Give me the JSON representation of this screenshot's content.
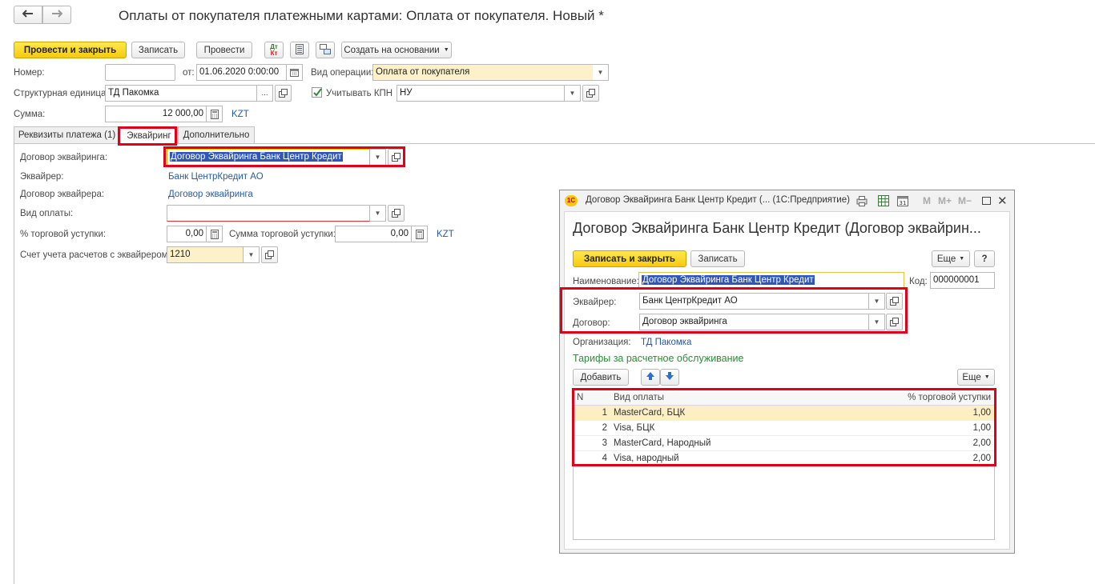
{
  "window": {
    "title": "Оплаты от покупателя платежными картами: Оплата от покупателя. Новый *"
  },
  "toolbar": {
    "post_close": "Провести и закрыть",
    "save": "Записать",
    "post": "Провести",
    "dt_kt_label_top": "Дт",
    "dt_kt_label_bottom": "Кт",
    "create_based": "Создать на основании"
  },
  "header": {
    "number_label": "Номер:",
    "number_value": "",
    "from_label": "от:",
    "date_value": "01.06.2020  0:00:00",
    "op_type_label": "Вид операции:",
    "op_type_value": "Оплата от покупателя",
    "unit_label": "Структурная единица:",
    "unit_value": "ТД Пакомка",
    "unit_ellipsis": "...",
    "kpn_label": "Учитывать КПН",
    "kpn_value": "НУ",
    "sum_label": "Сумма:",
    "sum_value": "12 000,00",
    "currency": "KZT"
  },
  "tabs": [
    {
      "label": "Реквизиты платежа (1)"
    },
    {
      "label": "Эквайринг"
    },
    {
      "label": "Дополнительно"
    }
  ],
  "acquiring": {
    "contract_label": "Договор эквайринга:",
    "contract_value": "Договор Эквайринга Банк Центр Кредит",
    "acquirer_label": "Эквайрер:",
    "acquirer_value": "Банк ЦентрКредит АО",
    "acq_contract_label": "Договор эквайрера:",
    "acq_contract_value": "Договор эквайринга",
    "pay_type_label": "Вид оплаты:",
    "pay_type_value": "",
    "discount_label": "% торговой уступки:",
    "discount_value": "0,00",
    "discount_sum_label": "Сумма торговой уступки:",
    "discount_sum_value": "0,00",
    "currency": "KZT",
    "account_label": "Счет учета расчетов с эквайрером:",
    "account_value": "1210"
  },
  "dialog": {
    "title": "Договор Эквайринга Банк Центр Кредит (...  (1С:Предприятие)",
    "heading": "Договор Эквайринга Банк Центр Кредит (Договор эквайрин...",
    "save_close": "Записать и закрыть",
    "save": "Записать",
    "more": "Еще",
    "help": "?",
    "m_buttons": [
      "M",
      "M+",
      "M−"
    ],
    "name_label": "Наименование:",
    "name_value": "Договор Эквайринга Банк Центр Кредит",
    "code_label": "Код:",
    "code_value": "000000001",
    "acquirer_label": "Эквайрер:",
    "acquirer_value": "Банк ЦентрКредит АО",
    "contract_label": "Договор:",
    "contract_value": "Договор эквайринга",
    "org_label": "Организация:",
    "org_value": "ТД Пакомка",
    "tariffs_title": "Тарифы за расчетное обслуживание",
    "add": "Добавить",
    "more2": "Еще",
    "columns": [
      "N",
      "Вид оплаты",
      "% торговой уступки"
    ],
    "rows": [
      {
        "n": "1",
        "type": "MasterCard, БЦК",
        "pct": "1,00"
      },
      {
        "n": "2",
        "type": "Visa, БЦК",
        "pct": "1,00"
      },
      {
        "n": "3",
        "type": "MasterCard, Народный",
        "pct": "2,00"
      },
      {
        "n": "4",
        "type": "Visa, народный",
        "pct": "2,00"
      }
    ]
  },
  "colors": {
    "accent_yellow": "#f7c910",
    "highlight_red": "#e1001a",
    "link_blue": "#2a5b9c",
    "green_title": "#2e8b3a",
    "selection_blue": "#2f57b7"
  }
}
